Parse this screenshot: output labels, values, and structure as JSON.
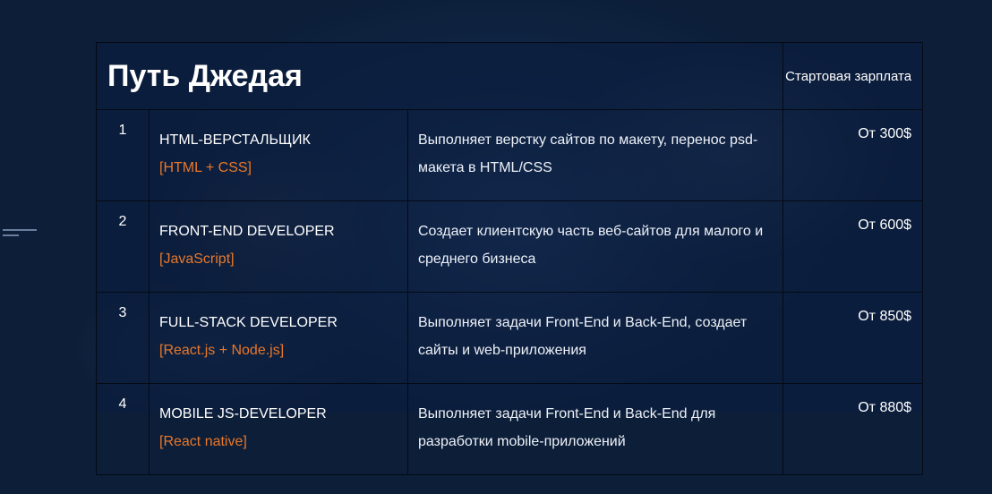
{
  "table": {
    "title": "Путь Джедая",
    "salary_header": "Стартовая зарплата",
    "rows": [
      {
        "num": "1",
        "role": "HTML-ВЕРСТАЛЬЩИК",
        "tech": "[HTML + CSS]",
        "desc": "Выполняет верстку сайтов по макету, перенос psd-макета в HTML/CSS",
        "salary": "От 300$"
      },
      {
        "num": "2",
        "role": "FRONT-END DEVELOPER",
        "tech": "[JavaScript]",
        "desc": "Создает клиентскую часть веб-сайтов для малого и среднего бизнеса",
        "salary": "От 600$"
      },
      {
        "num": "3",
        "role": "FULL-STACK DEVELOPER",
        "tech": "[React.js + Node.js]",
        "desc": "Выполняет задачи Front-End и Back-End, создает сайты и web-приложения",
        "salary": "От 850$"
      },
      {
        "num": "4",
        "role": "MOBILE JS-DEVELOPER",
        "tech": "[React native]",
        "desc": "Выполняет задачи Front-End и Back-End для разработки mobile-приложений",
        "salary": "От 880$"
      }
    ]
  },
  "colors": {
    "background": "#0c1e38",
    "tech_accent": "#e8782a",
    "text": "#ffffff",
    "border": "#050a14"
  }
}
